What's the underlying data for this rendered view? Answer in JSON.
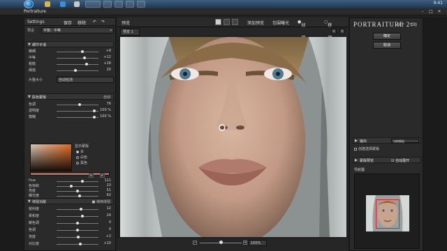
{
  "taskbar": {
    "tray_time": "9:41",
    "tray_icons": [
      "network-icon",
      "volume-icon",
      "battery-icon"
    ]
  },
  "window": {
    "title": "Portraiture",
    "controls": {
      "minimize": "–",
      "maximize": "□",
      "close": "✕"
    }
  },
  "left_panel": {
    "menu": {
      "settings": "Settings",
      "save": "保存",
      "delete": "移除",
      "undo": "↶",
      "redo": "↷"
    },
    "preset": {
      "label": "预设",
      "value": "平衡：中等"
    },
    "detail_section": {
      "title": "细节平滑",
      "sliders": [
        {
          "label": "精细",
          "value": "+8",
          "level": 0.62
        },
        {
          "label": "中等",
          "value": "+12",
          "level": 0.66
        },
        {
          "label": "粗糙",
          "value": "+18",
          "level": 0.72
        },
        {
          "label": "阈值",
          "value": "20",
          "level": 0.45
        }
      ],
      "size_select": {
        "label": "片整大小",
        "value": "自动检测"
      }
    },
    "skin_section": {
      "title": "肤色蒙版",
      "mode": "自动",
      "sliders": [
        {
          "label": "色调",
          "value": "76",
          "level": 0.55
        },
        {
          "label": "透明度",
          "value": "100 %",
          "level": 0.9
        },
        {
          "label": "模糊",
          "value": "100 %",
          "level": 0.9
        }
      ],
      "display_header": "显示蒙版",
      "radios": [
        {
          "label": "关",
          "checked": true
        },
        {
          "label": "白色",
          "checked": false
        },
        {
          "label": "黑色",
          "checked": false
        }
      ],
      "channels": [
        {
          "label": "Hue",
          "value": "111",
          "level": 0.62
        },
        {
          "label": "色饱和",
          "value": "23",
          "level": 0.35
        },
        {
          "label": "亮度",
          "value": "51",
          "level": 0.5
        },
        {
          "label": "曝光度",
          "value": "62",
          "level": 0.55
        }
      ]
    },
    "enhance_section": {
      "title": "增强功能",
      "toggle_label": "使用增强",
      "sliders": [
        {
          "label": "锐利度",
          "value": "12",
          "level": 0.58
        },
        {
          "label": "柔和度",
          "value": "24",
          "level": 0.62
        },
        {
          "label": "暖色调",
          "value": "0",
          "level": 0.5
        },
        {
          "label": "色调",
          "value": "0",
          "level": 0.5
        },
        {
          "label": "亮度",
          "value": "+2",
          "level": 0.52
        },
        {
          "label": "对比度",
          "value": "+10",
          "level": 0.56
        }
      ]
    }
  },
  "center": {
    "preview_label": "预览",
    "toolbar": {
      "add_preview": "添加预览",
      "wrap_exposure": "包围曝光",
      "create_preview": "创建预览",
      "pin_preview": "移除预览"
    },
    "tab": {
      "label": "预览 1"
    },
    "zoom": {
      "value": "100%"
    }
  },
  "right_panel": {
    "brand": "PORTRAITURE 2",
    "menu": {
      "about": "关于",
      "help": "帮助"
    },
    "ok_label": "确定",
    "cancel_label": "取消",
    "output": {
      "label": "输出",
      "value": "当前图层"
    },
    "create_mask_label": "创建选择蒙版",
    "mask_preview": {
      "label": "蒙版预览",
      "auto_label": "自动展开"
    },
    "navigator_label": "导航器"
  },
  "colors": {
    "panel": "#2a2a2a",
    "accent_red": "#e02020",
    "skin_swatch": "#e36a23"
  }
}
